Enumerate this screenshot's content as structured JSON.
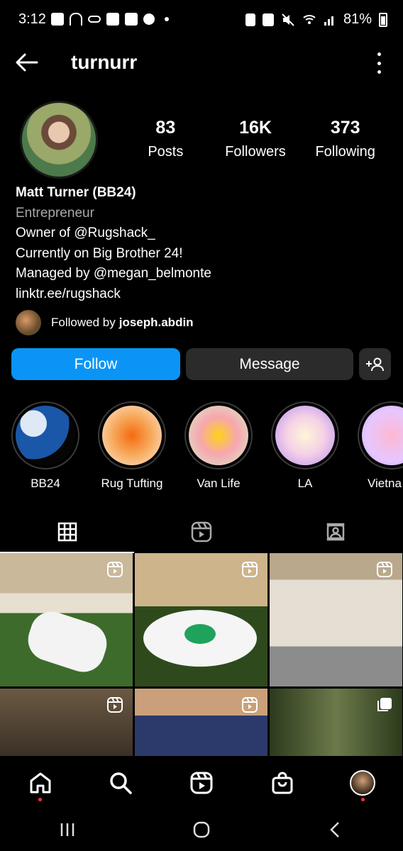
{
  "status": {
    "time": "3:12",
    "battery": "81%"
  },
  "header": {
    "username": "turnurr"
  },
  "stats": [
    {
      "num": "83",
      "label": "Posts"
    },
    {
      "num": "16K",
      "label": "Followers"
    },
    {
      "num": "373",
      "label": "Following"
    }
  ],
  "bio": {
    "name": "Matt Turner (BB24)",
    "category": "Entrepreneur",
    "line1": "Owner of @Rugshack_",
    "line2": "Currently on Big Brother 24!",
    "line3": "Managed by @megan_belmonte",
    "link": "linktr.ee/rugshack"
  },
  "followed_by": {
    "prefix": "Followed by",
    "user": "joseph.abdin"
  },
  "buttons": {
    "follow": "Follow",
    "message": "Message"
  },
  "highlights": [
    {
      "label": "BB24"
    },
    {
      "label": "Rug Tufting"
    },
    {
      "label": "Van Life"
    },
    {
      "label": "LA"
    },
    {
      "label": "Vietna"
    }
  ],
  "icons": {
    "back": "arrow-left-icon",
    "menu": "more-vertical-icon",
    "grid_tab": "grid-icon",
    "reels_tab": "reels-icon",
    "tagged_tab": "tagged-icon",
    "home": "home-icon",
    "search": "search-icon",
    "reels": "reels-icon",
    "shop": "shopping-bag-icon",
    "add_user": "add-user-icon"
  },
  "colors": {
    "follow": "#0a95f6",
    "secondary_button": "#2b2b2b",
    "notification": "#ff3040"
  }
}
